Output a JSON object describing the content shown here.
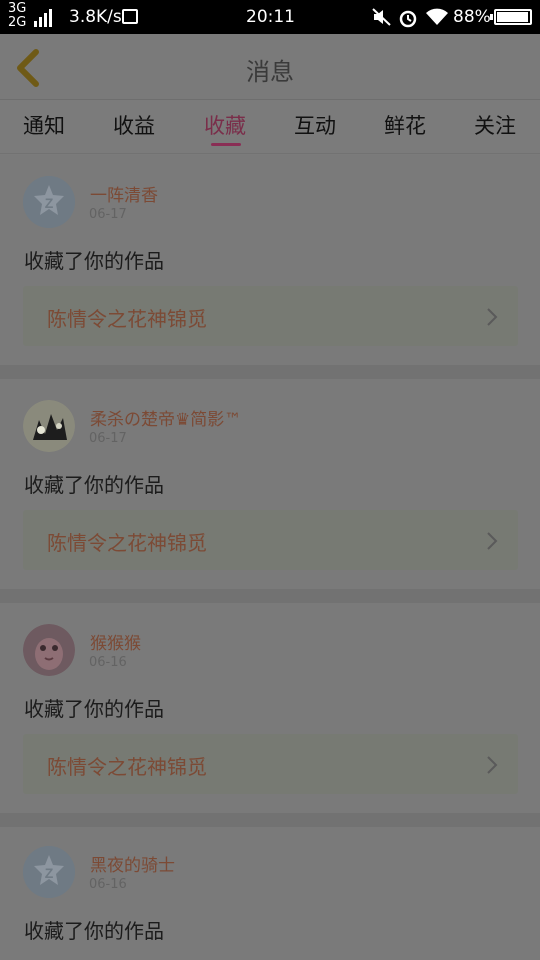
{
  "status_bar": {
    "network_top": "3G",
    "network_bottom": "2G",
    "speed": "3.8K/s",
    "time": "20:11",
    "battery": "88%"
  },
  "navbar": {
    "title": "消息"
  },
  "tabs": [
    {
      "label": "通知",
      "active": false
    },
    {
      "label": "收益",
      "active": false
    },
    {
      "label": "收藏",
      "active": true
    },
    {
      "label": "互动",
      "active": false
    },
    {
      "label": "鲜花",
      "active": false
    },
    {
      "label": "关注",
      "active": false
    }
  ],
  "messages": [
    {
      "user": "一阵清香",
      "date": "06-17",
      "action": "收藏了你的作品",
      "work": "陈情令之花神锦觅",
      "avatar": "default-avatar-icon"
    },
    {
      "user": "柔杀の楚帝♛简影™",
      "date": "06-17",
      "action": "收藏了你的作品",
      "work": "陈情令之花神锦觅",
      "avatar": "photo-avatar"
    },
    {
      "user": "猴猴猴",
      "date": "06-16",
      "action": "收藏了你的作品",
      "work": "陈情令之花神锦觅",
      "avatar": "photo-avatar"
    },
    {
      "user": "黑夜的骑士",
      "date": "06-16",
      "action": "收藏了你的作品",
      "work": "",
      "avatar": "default-avatar-icon"
    }
  ],
  "colors": {
    "accent": "#8a2e55",
    "username": "#7c4a35",
    "back_arrow": "#6f5a16"
  }
}
